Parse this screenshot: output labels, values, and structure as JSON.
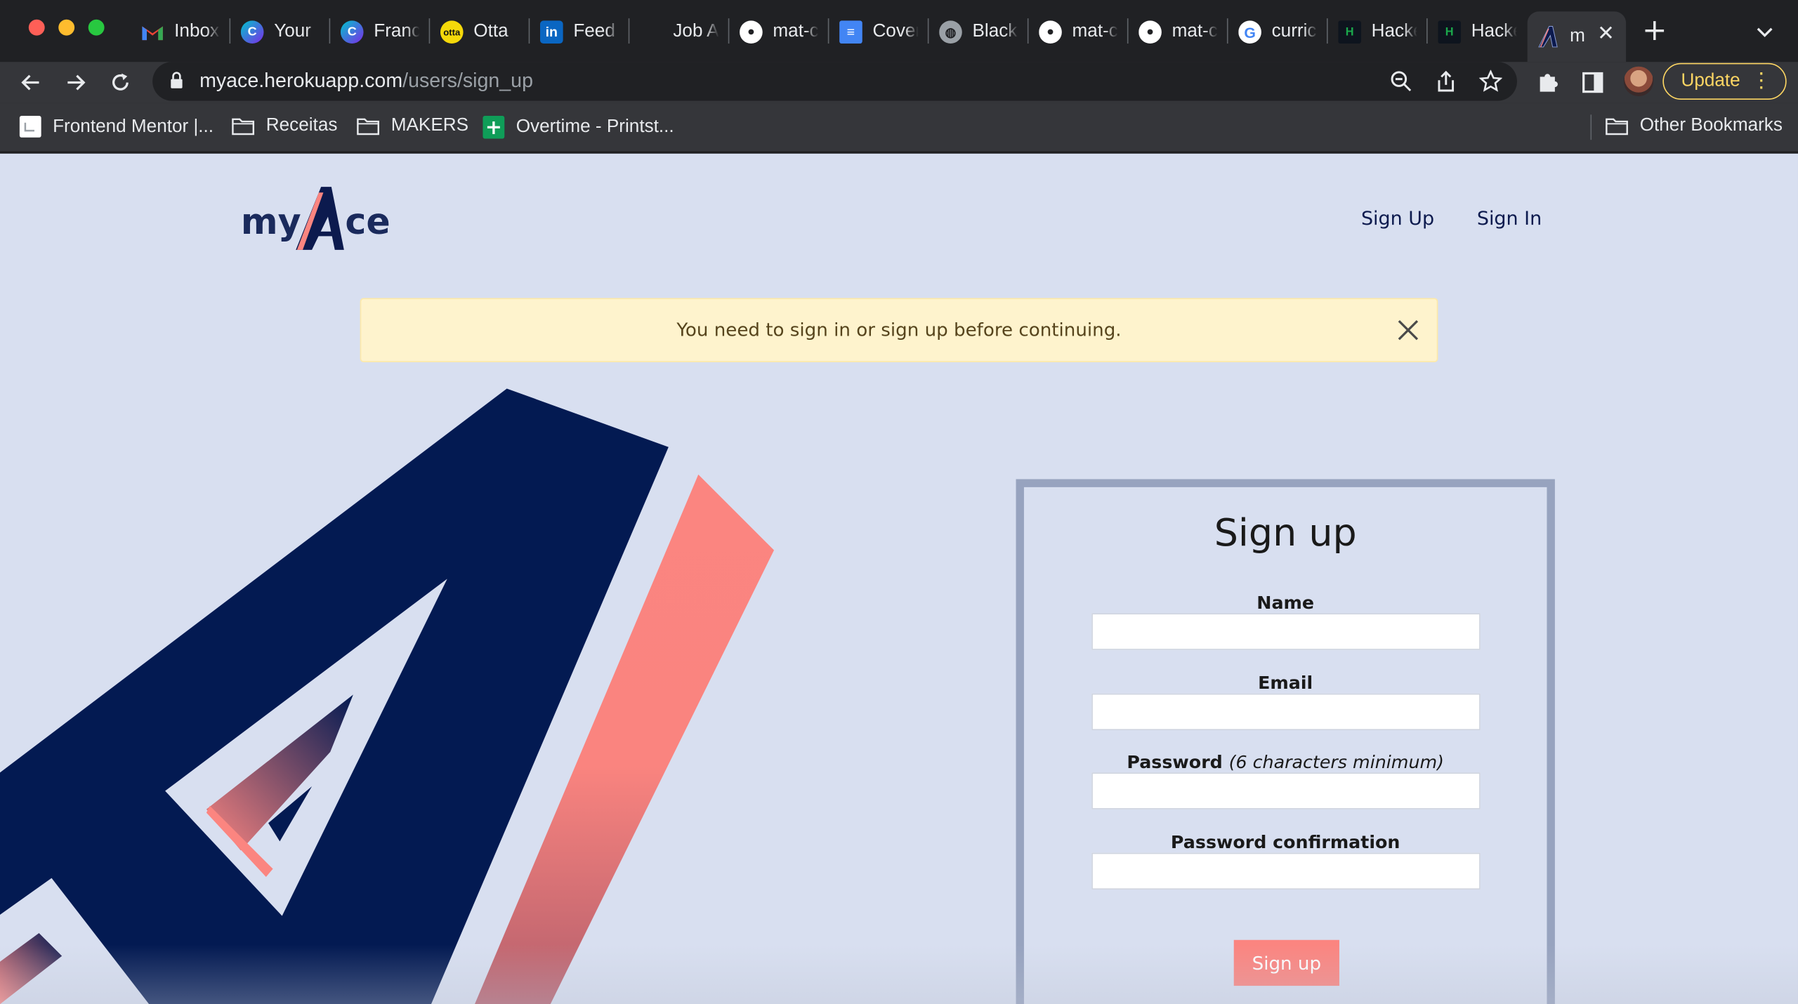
{
  "browser": {
    "tabs": [
      {
        "label": "Inbox",
        "icon": "gmail-icon",
        "color": "#ea4335"
      },
      {
        "label": "Your ",
        "icon": "canva-icon",
        "color": "#7d2ae8"
      },
      {
        "label": "Franc",
        "icon": "canva-icon",
        "color": "#7d2ae8"
      },
      {
        "label": "Otta",
        "icon": "otta-icon",
        "color": "#f5c518"
      },
      {
        "label": "Feed",
        "icon": "linkedin-icon",
        "color": "#0a66c2"
      },
      {
        "label": "Job A",
        "icon": "blank-icon",
        "color": "#202124"
      },
      {
        "label": "mat-c",
        "icon": "github-icon",
        "color": "#ffffff"
      },
      {
        "label": "Cover",
        "icon": "google-docs-icon",
        "color": "#4285f4"
      },
      {
        "label": "Black",
        "icon": "globe-icon",
        "color": "#9aa0a6"
      },
      {
        "label": "mat-c",
        "icon": "github-icon",
        "color": "#ffffff"
      },
      {
        "label": "mat-c",
        "icon": "github-icon",
        "color": "#ffffff"
      },
      {
        "label": "curric",
        "icon": "google-icon",
        "color": "#ffffff"
      },
      {
        "label": "Hacke",
        "icon": "hackerrank-icon",
        "color": "#1ba94c"
      },
      {
        "label": "Hacke",
        "icon": "hackerrank-icon",
        "color": "#1ba94c"
      },
      {
        "label": "m",
        "icon": "myace-icon",
        "color": "#0c1a4e"
      }
    ],
    "url_host": "myace.herokuapp.com",
    "url_path": "/users/sign_up",
    "update_label": "Update",
    "bookmarks": [
      {
        "label": "Frontend Mentor |...",
        "icon": "frontend-mentor-icon"
      },
      {
        "label": "Receitas",
        "icon": "folder-icon"
      },
      {
        "label": "MAKERS",
        "icon": "folder-icon"
      },
      {
        "label": "Overtime - Printst...",
        "icon": "google-sheets-icon"
      }
    ],
    "other_bookmarks": "Other Bookmarks"
  },
  "site": {
    "logo_text": "myAce",
    "nav": {
      "sign_up": "Sign Up",
      "sign_in": "Sign In"
    },
    "flash": "You need to sign in or sign up before continuing."
  },
  "form": {
    "title": "Sign up",
    "name_label": "Name",
    "email_label": "Email",
    "password_label": "Password",
    "password_hint": "(6 characters minimum)",
    "password_confirmation_label": "Password confirmation",
    "submit_label": "Sign up"
  },
  "colors": {
    "navy": "#031a52",
    "coral": "#fb8580",
    "page_bg": "#d8dff0",
    "flash_bg": "#fef3cd"
  }
}
